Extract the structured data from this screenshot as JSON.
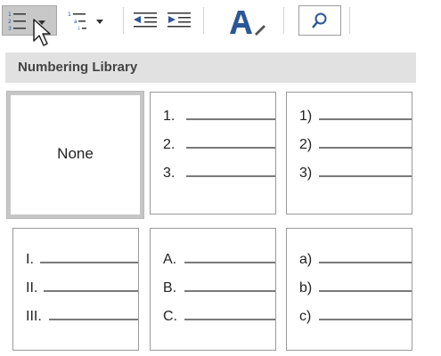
{
  "dropdown": {
    "header": "Numbering Library",
    "tiles": [
      {
        "label": "None"
      },
      {
        "markers": [
          "1.",
          "2.",
          "3."
        ]
      },
      {
        "markers": [
          "1)",
          "2)",
          "3)"
        ]
      },
      {
        "markers": [
          "I.",
          "II.",
          "III."
        ]
      },
      {
        "markers": [
          "A.",
          "B.",
          "C."
        ]
      },
      {
        "markers": [
          "a)",
          "b)",
          "c)"
        ]
      }
    ]
  },
  "colors": {
    "accent_blue": "#2b5797",
    "header_bg": "#e1e1e1",
    "pressed_bg": "#c8c8c8"
  }
}
